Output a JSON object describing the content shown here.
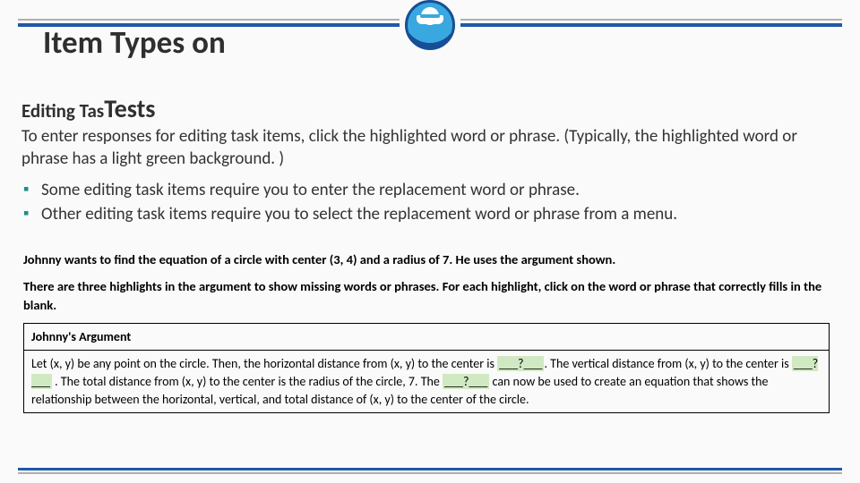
{
  "title": {
    "line1": "Item Types on"
  },
  "subtitle": {
    "prefix": "Editing Tas",
    "overlay": "Tests"
  },
  "body": {
    "intro": "To enter responses for editing task items, click the highlighted word or phrase. (Typically, the highlighted word or phrase has a light green background. )",
    "bullets": [
      "Some editing task items require you to enter the replacement word or phrase.",
      "Other editing task items require you to select the replacement word or phrase from a menu."
    ]
  },
  "example": {
    "problem": "Johnny wants to find the equation of a circle with center (3,  4) and a radius of 7. He uses the argument shown.",
    "instructions": "There are three highlights in the argument to show missing words or phrases. For each highlight, click on the word or phrase that correctly fills in the blank.",
    "table_header": "Johnny's Argument",
    "blank": "___?___",
    "argument_segments": [
      "Let (x, y) be any point on the circle. Then, the horizontal distance from (x, y) to the center is ",
      ". The vertical distance from (x, y) to the center is ",
      " . The total distance from (x, y) to the center is the radius of the circle, 7. The ",
      " can now be used to create an equation that shows the relationship between the horizontal, vertical, and total distance of (x, y) to the center of the circle."
    ]
  }
}
